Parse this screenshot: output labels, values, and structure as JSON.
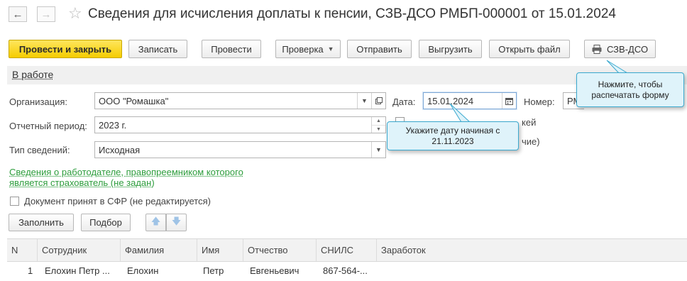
{
  "header": {
    "title": "Сведения для исчисления доплаты к пенсии, СЗВ-ДСО РМБП-000001 от 15.01.2024",
    "back_icon": "arrow-left-icon",
    "forward_icon": "arrow-right-icon",
    "favorite_icon": "star-icon"
  },
  "toolbar": {
    "post_close": "Провести и закрыть",
    "write": "Записать",
    "post": "Провести",
    "check": "Проверка",
    "send": "Отправить",
    "export": "Выгрузить",
    "open_file": "Открыть файл",
    "print_szv": "СЗВ-ДСО"
  },
  "status": {
    "label": "В работе"
  },
  "form": {
    "organization": {
      "label": "Организация:",
      "value": "ООО \"Ромашка\""
    },
    "period": {
      "label": "Отчетный период:",
      "value": "2023 г."
    },
    "info_type": {
      "label": "Тип сведений:",
      "value": "Исходная"
    },
    "date": {
      "label": "Дата:",
      "value": "15.01.2024"
    },
    "number": {
      "label": "Номер:",
      "value": "РМ"
    },
    "partial_right_1": "кей",
    "partial_right_2": "чие)",
    "employer_link_line1": "Сведения о работодателе, правопреемником которого",
    "employer_link_line2": "является страхователь (не задан)",
    "accepted_checkbox": "Документ принят в СФР (не редактируется)"
  },
  "table_toolbar": {
    "fill": "Заполнить",
    "select": "Подбор"
  },
  "table": {
    "columns": [
      "N",
      "Сотрудник",
      "Фамилия",
      "Имя",
      "Отчество",
      "СНИЛС",
      "Заработок"
    ],
    "rows": [
      [
        "1",
        "Елохин Петр ...",
        "Елохин",
        "Петр",
        "Евгеньевич",
        "867-564-...",
        ""
      ]
    ]
  },
  "callouts": {
    "print": "Нажмите, чтобы распечатать форму",
    "date_hint": "Укажите дату начиная с 21.11.2023"
  },
  "colors": {
    "primary_button": "#f5cc00",
    "link_green": "#2d9d3c",
    "callout_bg": "#dff3fa",
    "callout_border": "#3aa9cf"
  }
}
